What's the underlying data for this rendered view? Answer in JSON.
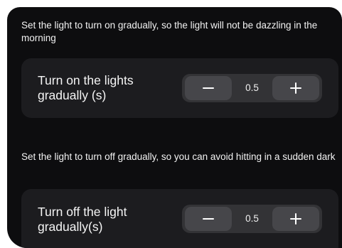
{
  "fade_on": {
    "description": "Set the light to turn on gradually, so the light will not be dazzling in the morning",
    "label": "Turn on the lights gradually (s)",
    "value": "0.5",
    "minus_icon": "minus-icon",
    "plus_icon": "plus-icon"
  },
  "fade_off": {
    "description": "Set the light to turn off gradually, so you can avoid hitting in a sudden dark",
    "label": "Turn off the light gradually(s)",
    "value": "0.5",
    "minus_icon": "minus-icon",
    "plus_icon": "plus-icon"
  },
  "colors": {
    "background": "#0d0d0f",
    "card": "#1c1c1f",
    "stepper_track": "#333336",
    "stepper_button": "#46464a",
    "text": "#ffffff"
  }
}
